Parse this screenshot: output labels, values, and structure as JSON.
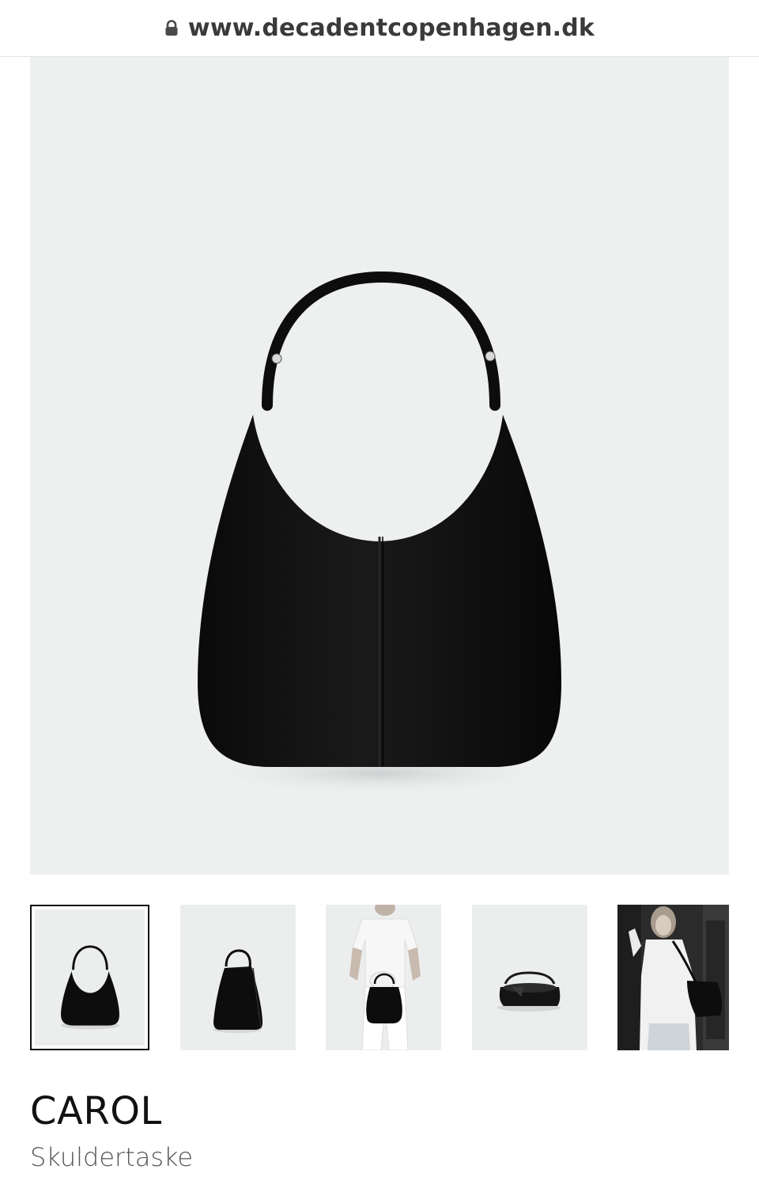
{
  "browser": {
    "url": "www.decadentcopenhagen.dk",
    "lock_icon": "lock-icon"
  },
  "gallery": {
    "main_image": "black-leather-shoulder-bag-front",
    "thumbnails": [
      {
        "image": "bag-front",
        "selected": true
      },
      {
        "image": "bag-side",
        "selected": false
      },
      {
        "image": "model-holding-bag",
        "selected": false
      },
      {
        "image": "bag-open-interior",
        "selected": false
      },
      {
        "image": "model-wearing-bag",
        "selected": false
      }
    ]
  },
  "product": {
    "name": "CAROL",
    "subtitle": "Skuldertaske"
  },
  "colors": {
    "image_background": "#eef0f0",
    "bag": "#0d0d0d",
    "text": "#111111",
    "subtitle": "#555555"
  }
}
